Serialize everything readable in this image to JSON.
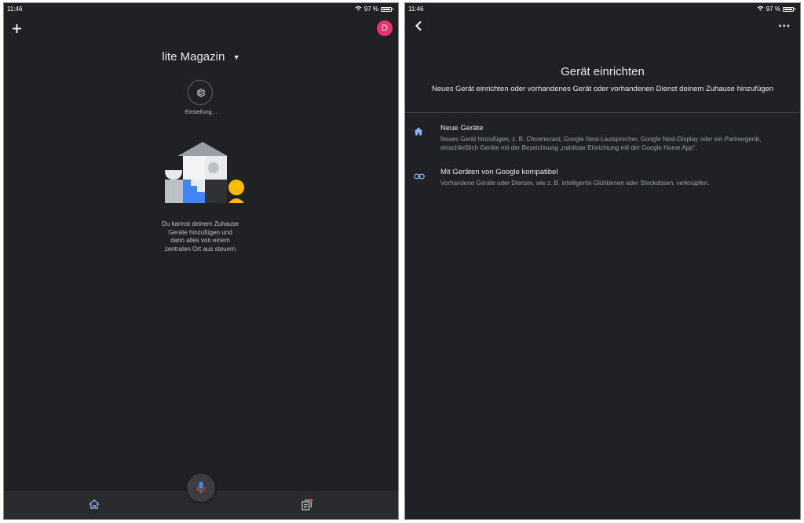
{
  "left": {
    "status": {
      "time": "11:46",
      "battery": "97 %"
    },
    "avatar_letter": "D",
    "home_name": "lite Magazin",
    "settings_label": "Einstellung…",
    "empty_message": "Du kannst deinem Zuhause Geräte hinzufügen und dann alles von einem zentralen Ort aus steuern",
    "icons": {
      "add": "plus-icon",
      "settings": "gear-icon",
      "home_dropdown": "caret-down-icon",
      "nav_home": "home-icon",
      "nav_feed": "feed-icon",
      "mic": "mic-icon"
    }
  },
  "right": {
    "status": {
      "time": "11:46",
      "battery": "97 %"
    },
    "title": "Gerät einrichten",
    "subtitle": "Neues Gerät einrichten oder vorhandenes Gerät oder vorhandenen Dienst deinem Zuhause hinzufügen",
    "options": [
      {
        "title": "Neue Geräte",
        "description": "Neues Gerät hinzufügen, z. B. Chromecast, Google Nest-Lautsprecher, Google Nest-Display oder ein Partnergerät, einschließlich Geräte mit der Bezeichnung „nahtlose Einrichtung mit der Google Home App“.",
        "icon": "home-icon"
      },
      {
        "title": "Mit Geräten von Google kompatibel",
        "description": "Vorhandene Geräte oder Dienste, wie z. B. intelligente Glühbirnen oder Steckdosen, verknüpfen.",
        "icon": "link-icon"
      }
    ],
    "icons": {
      "back": "chevron-left-icon",
      "more": "more-horizontal-icon"
    }
  },
  "colors": {
    "background": "#202124",
    "accent_blue": "#8ab4f8",
    "avatar": "#e8336b",
    "illustration_blue": "#4285f4",
    "illustration_yellow": "#fbbc04"
  }
}
